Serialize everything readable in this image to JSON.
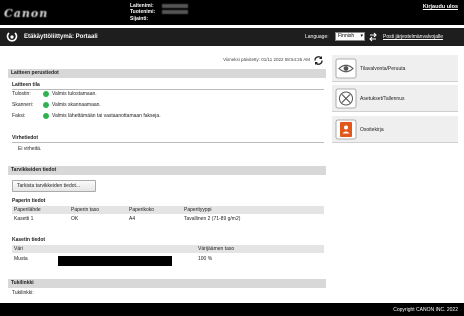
{
  "header": {
    "logo_text": "Canon",
    "device_name_label": "Laitenimi:",
    "product_name_label": "Tuotenimi:",
    "location_label": "Sijainti:",
    "logout": "Kirjaudu ulos"
  },
  "titlebar": {
    "title": "Etäkäyttöliittymä: Portaali",
    "language_label": "Language:",
    "language_value": "Finnish",
    "switch_link": "Posti järjestelmänvalvojalle"
  },
  "status": {
    "last_updated": "Viimeksi päivitetty: 01/11 2022 08:54:25 AM",
    "device_info_header": "Laitteen perustiedot",
    "device_state_title": "Laitteen tila",
    "rows": [
      {
        "key": "Tulostin:",
        "value": "Valmis tulostamaan."
      },
      {
        "key": "Skanneri:",
        "value": "Valmis skannaamaan."
      },
      {
        "key": "Faksi:",
        "value": "Valmis lähettämään tai vastaanottamaan fakseja."
      }
    ],
    "error_title": "Virhetiedot",
    "error_value": "Ei virheitä."
  },
  "consumables": {
    "header": "Tarvikkeiden tiedot",
    "check_button": "Tarkista tarvikkeiden tiedot...",
    "paper_title": "Paperin tiedot",
    "paper_columns": [
      "Paperilähde",
      "Paperin taso",
      "Paperikoko",
      "Paperityyppi"
    ],
    "paper_rows": [
      [
        "Kasetti 1",
        "OK",
        "A4",
        "Tavallinen 2 (71-89 g/m2)"
      ]
    ],
    "toner_title": "Kasetin tiedot",
    "toner_columns": [
      "Väri",
      "",
      "Värijäämen taso"
    ],
    "toner_rows": [
      [
        "Musta",
        "",
        "100 %"
      ]
    ],
    "toner_level_fraction": 1.0
  },
  "support": {
    "header": "Tukilinkki",
    "value": "Tukilinkki:"
  },
  "side": [
    {
      "label": "Tilavalvonta/Peruuta",
      "icon": "monitor-eye-icon"
    },
    {
      "label": "Asetukset/Tallennus",
      "icon": "settings-tools-icon"
    },
    {
      "label": "Osoitekirja",
      "icon": "address-book-icon"
    }
  ],
  "footer": {
    "copyright": "Copyright CANON INC. 2022"
  },
  "colors": {
    "ready_green": "#2fb24f",
    "header_black": "#000000",
    "addressbook_orange": "#e2581c"
  }
}
